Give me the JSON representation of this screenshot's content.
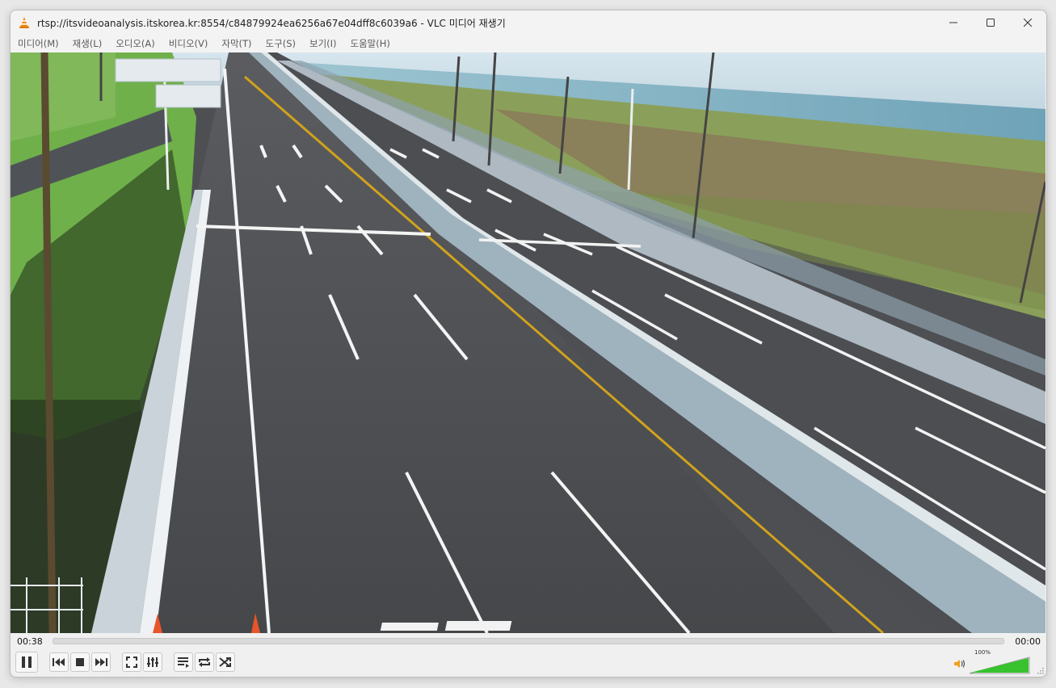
{
  "window": {
    "title": "rtsp://itsvideoanalysis.itskorea.kr:8554/c84879924ea6256a67e04dff8c6039a6 - VLC 미디어 재생기",
    "app_icon": "vlc-cone-icon",
    "controls": [
      "minimize-icon",
      "maximize-icon",
      "close-icon"
    ]
  },
  "menu": {
    "items": [
      "미디어(M)",
      "재생(L)",
      "오디오(A)",
      "비디오(V)",
      "자막(T)",
      "도구(S)",
      "보기(I)",
      "도움말(H)"
    ]
  },
  "playback": {
    "elapsed": "00:38",
    "total": "00:00",
    "progress": 0
  },
  "controls": {
    "buttons": [
      "pause-icon",
      "previous-icon",
      "stop-icon",
      "next-icon",
      "fullscreen-icon",
      "extended-settings-icon",
      "playlist-icon",
      "loop-icon",
      "shuffle-icon"
    ]
  },
  "volume": {
    "percent_label": "100%",
    "level": 1.0,
    "icon": "speaker-icon",
    "accent": "#37c22e"
  }
}
